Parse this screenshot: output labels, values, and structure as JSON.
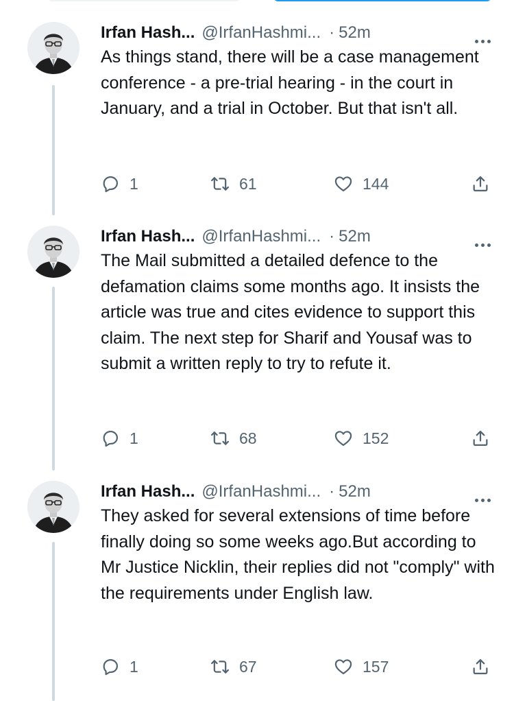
{
  "tweets": [
    {
      "name": "Irfan Hash...",
      "handle": "@IrfanHashmi...",
      "separator": "·",
      "time": "52m",
      "text": "As things stand, there will be a case management conference - a pre-trial hearing - in the court in January, and a trial in October. But that isn't all.",
      "replies": "1",
      "retweets": "61",
      "likes": "144"
    },
    {
      "name": "Irfan Hash...",
      "handle": "@IrfanHashmi...",
      "separator": "·",
      "time": "52m",
      "text": "The Mail submitted a detailed defence to the defamation claims some months ago. It insists the article was true and cites evidence to support this claim. The next step for Sharif and Yousaf was to submit a written reply to try to refute it.",
      "replies": "1",
      "retweets": "68",
      "likes": "152"
    },
    {
      "name": "Irfan Hash...",
      "handle": "@IrfanHashmi...",
      "separator": "·",
      "time": "52m",
      "text": "They asked for several extensions of time before finally doing so some weeks ago.But according to Mr Justice Nicklin, their replies did not \"comply\" with the requirements under English law.",
      "replies": "1",
      "retweets": "67",
      "likes": "157"
    }
  ],
  "icons": {
    "reply": "reply-icon",
    "retweet": "retweet-icon",
    "like": "heart-icon",
    "share": "share-icon",
    "more": "more-icon"
  },
  "colors": {
    "text": "#0f1419",
    "secondary": "#536471",
    "thread_line": "#cfd9de",
    "accent": "#1d9bf0"
  }
}
